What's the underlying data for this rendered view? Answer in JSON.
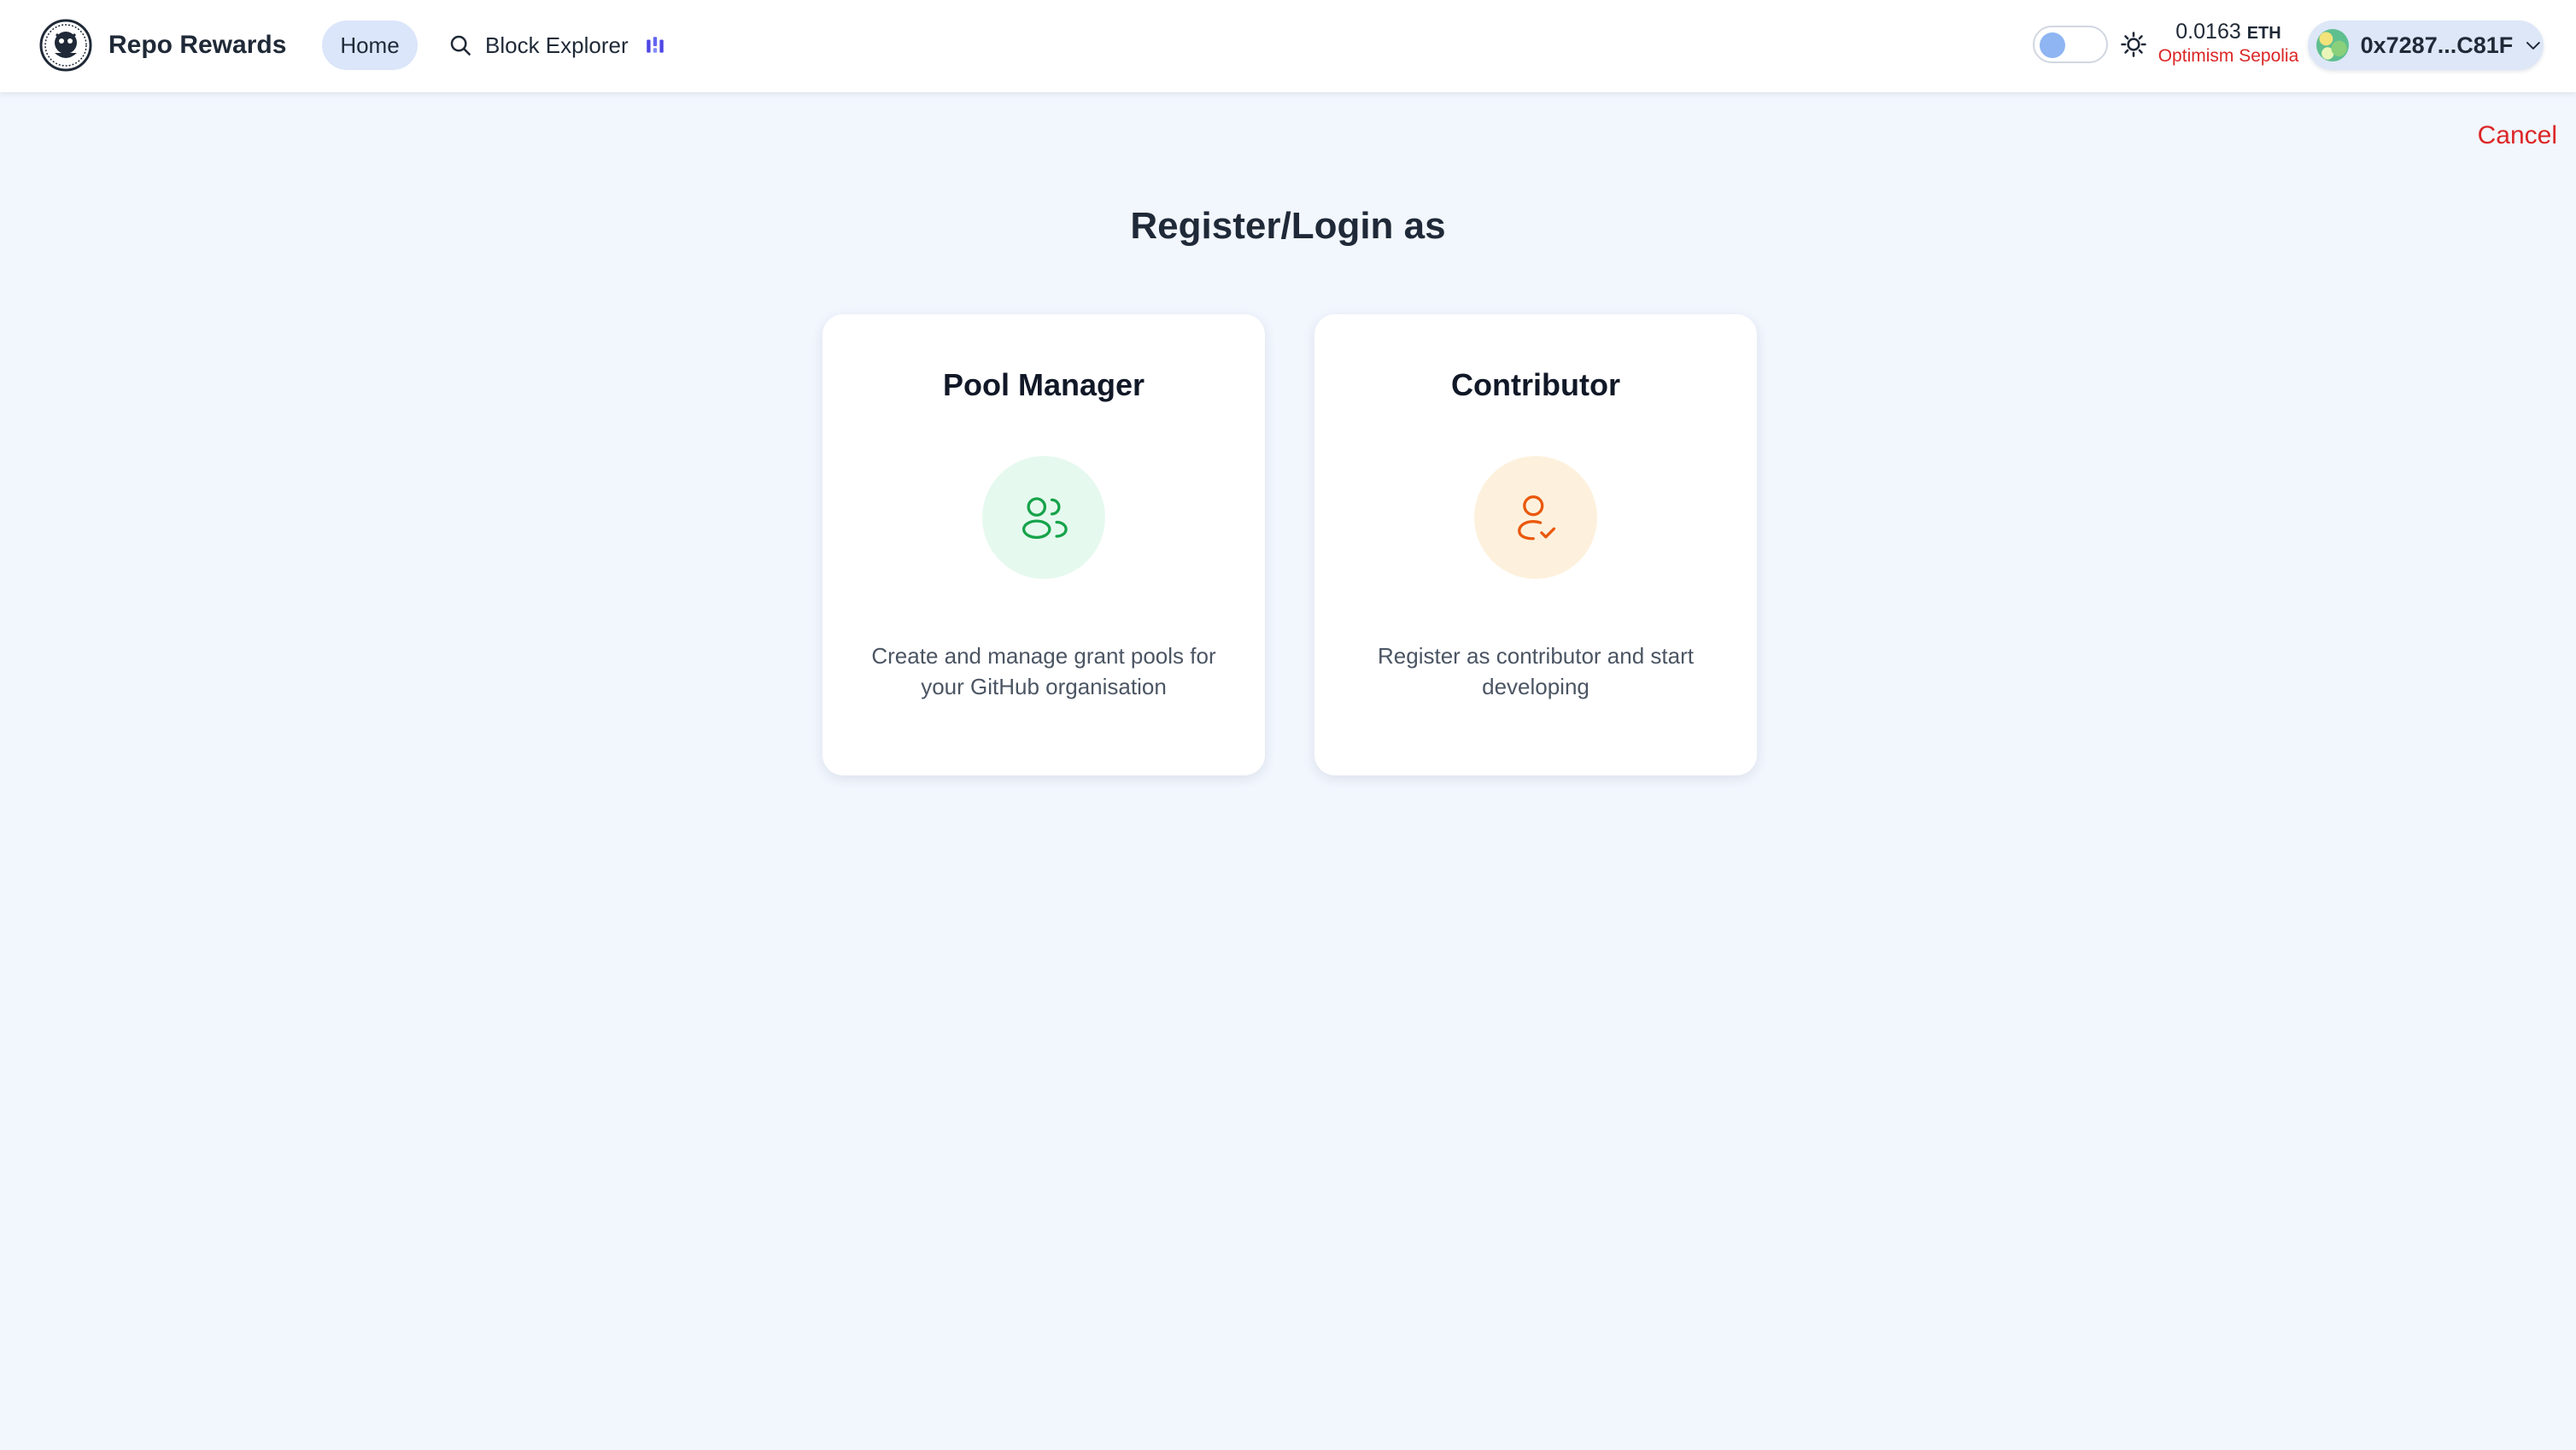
{
  "header": {
    "brand": "Repo Rewards",
    "nav": {
      "home": "Home",
      "block_explorer": "Block Explorer"
    },
    "balance": {
      "amount": "0.0163",
      "unit": "ETH",
      "network": "Optimism Sepolia"
    },
    "account": {
      "address": "0x7287...C81F"
    },
    "theme_toggle": {
      "state": "off"
    }
  },
  "main": {
    "cancel": "Cancel",
    "title": "Register/Login as",
    "cards": [
      {
        "title": "Pool Manager",
        "icon": "users-icon",
        "description": "Create and manage grant pools for your GitHub organisation"
      },
      {
        "title": "Contributor",
        "icon": "user-check-icon",
        "description": "Register as contributor and start developing"
      }
    ]
  },
  "colors": {
    "background": "#f2f6fd",
    "accent_red": "#dc2626",
    "pool_manager_icon": "#16a34a",
    "contributor_icon": "#ea580c",
    "nav_active": "#dbe6fb"
  }
}
